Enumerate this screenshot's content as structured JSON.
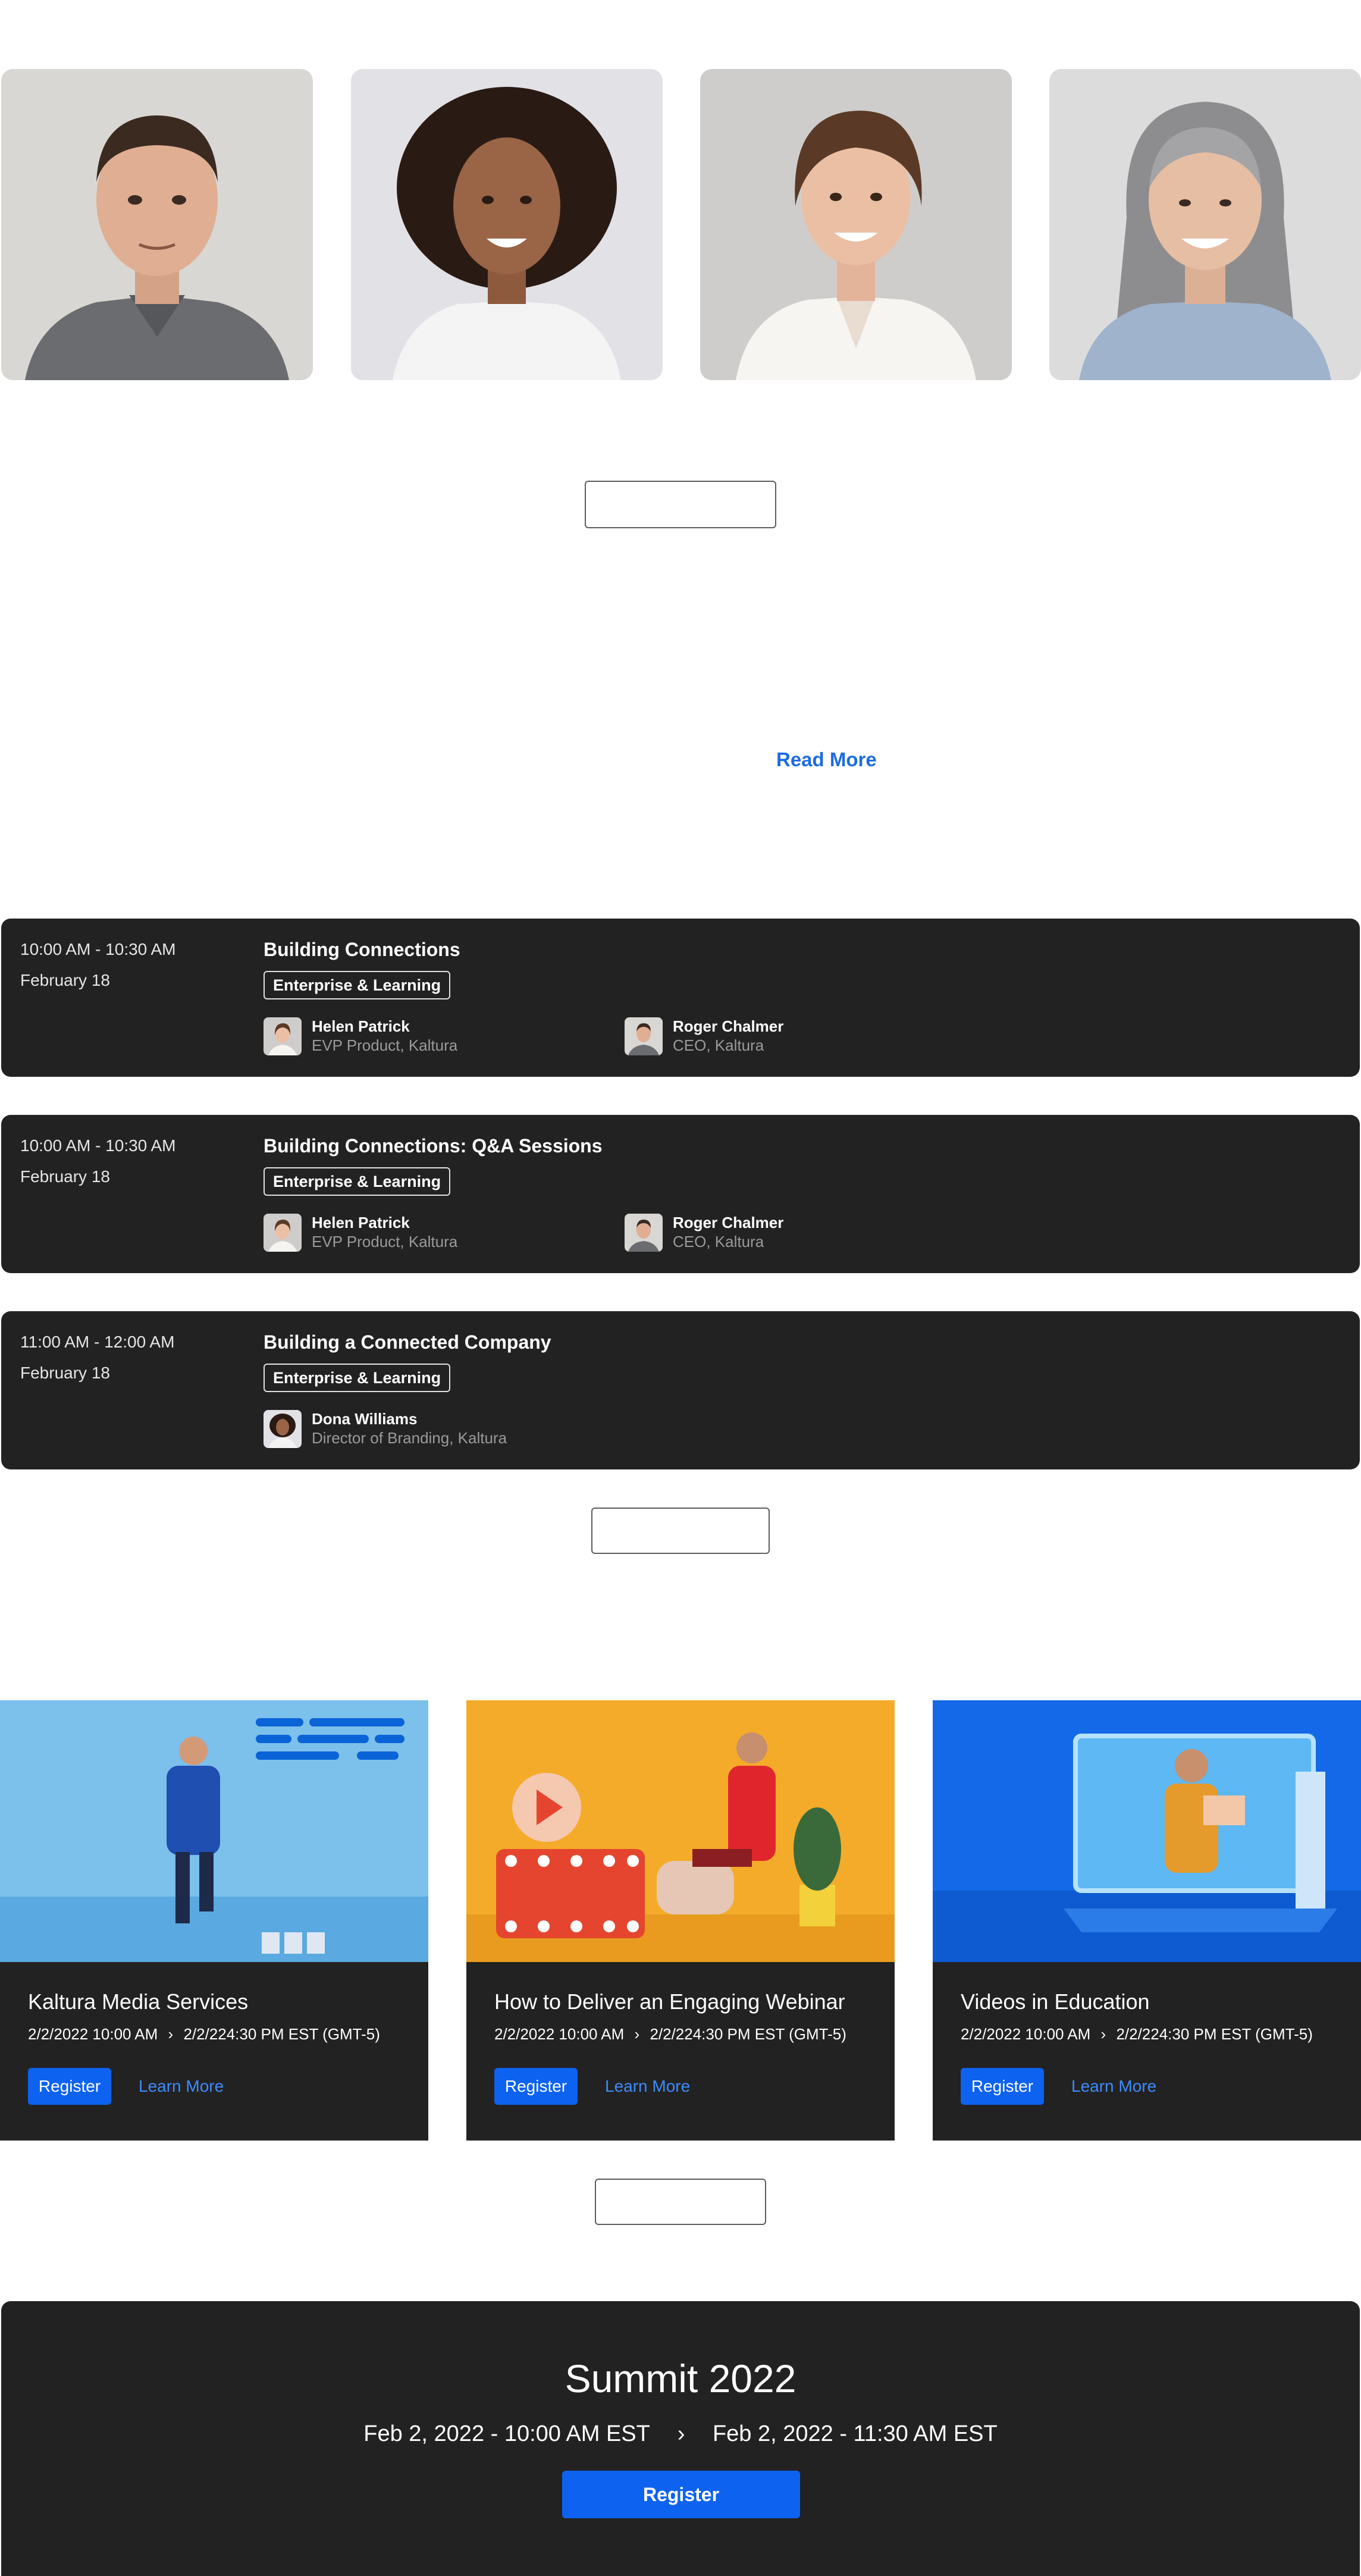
{
  "speakers_gallery": [
    {
      "icon": "speaker-photo-man"
    },
    {
      "icon": "speaker-photo-woman-curly"
    },
    {
      "icon": "speaker-photo-woman-short-hair"
    },
    {
      "icon": "speaker-photo-woman-gray-hair"
    }
  ],
  "about": {
    "read_more_label": "Read More"
  },
  "sessions": [
    {
      "time": "10:00 AM - 10:30 AM",
      "date": "February 18",
      "title": "Building Connections",
      "tag": "Enterprise & Learning",
      "speakers": [
        {
          "name": "Helen Patrick",
          "role": "EVP Product, Kaltura"
        },
        {
          "name": "Roger Chalmer",
          "role": "CEO, Kaltura"
        }
      ]
    },
    {
      "time": "10:00 AM - 10:30 AM",
      "date": "February 18",
      "title": "Building Connections: Q&A Sessions",
      "tag": "Enterprise & Learning",
      "speakers": [
        {
          "name": "Helen Patrick",
          "role": "EVP Product, Kaltura"
        },
        {
          "name": "Roger Chalmer",
          "role": "CEO, Kaltura"
        }
      ]
    },
    {
      "time": "11:00 AM - 12:00 AM",
      "date": "February 18",
      "title": "Building a Connected Company",
      "tag": "Enterprise & Learning",
      "speakers": [
        {
          "name": "Dona Williams",
          "role": "Director of Branding, Kaltura"
        }
      ]
    }
  ],
  "events": [
    {
      "title": "Kaltura Media Services",
      "start": "2/2/2022 10:00 AM",
      "end": "2/2/224:30 PM EST (GMT-5)",
      "register_label": "Register",
      "learn_more_label": "Learn More"
    },
    {
      "title": "How to Deliver an Engaging Webinar",
      "start": "2/2/2022 10:00 AM",
      "end": "2/2/224:30 PM EST (GMT-5)",
      "register_label": "Register",
      "learn_more_label": "Learn More"
    },
    {
      "title": "Videos in Education",
      "start": "2/2/2022 10:00 AM",
      "end": "2/2/224:30 PM EST (GMT-5)",
      "register_label": "Register",
      "learn_more_label": "Learn More"
    }
  ],
  "summit": {
    "title": "Summit 2022",
    "start": "Feb 2, 2022 - 10:00 AM EST",
    "end": "Feb 2, 2022 - 11:30 AM EST",
    "register_label": "Register"
  },
  "colors": {
    "card_bg": "#222222",
    "accent": "#0d62f0",
    "link": "#1c6ce0"
  }
}
